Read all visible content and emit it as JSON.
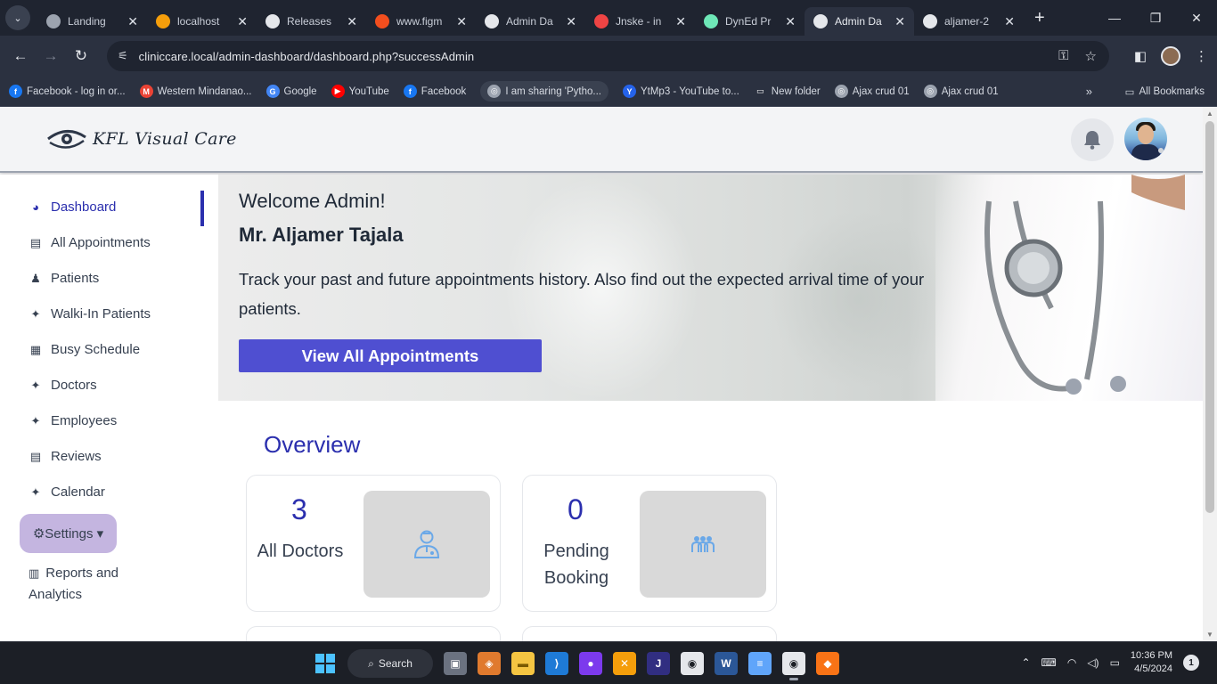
{
  "browser": {
    "tabs": [
      {
        "title": "Landing",
        "color": "#9ca3af"
      },
      {
        "title": "localhost",
        "color": "#f59e0b"
      },
      {
        "title": "Releases",
        "color": "#e5e7eb"
      },
      {
        "title": "www.figm",
        "color": "#f24e1e"
      },
      {
        "title": "Admin Da",
        "color": "#e5e7eb"
      },
      {
        "title": "Jnske - in",
        "color": "#ef4444"
      },
      {
        "title": "DynEd Pr",
        "color": "#6ee7b7"
      },
      {
        "title": "Admin Da",
        "color": "#e5e7eb"
      },
      {
        "title": "aljamer-2",
        "color": "#e5e7eb"
      }
    ],
    "url": "cliniccare.local/admin-dashboard/dashboard.php?successAdmin",
    "bookmarks": [
      {
        "label": "Facebook - log in or...",
        "color": "#1877f2",
        "glyph": "f"
      },
      {
        "label": "Western Mindanao...",
        "color": "#ea4335",
        "glyph": "M"
      },
      {
        "label": "Google",
        "color": "#4285f4",
        "glyph": "G"
      },
      {
        "label": "YouTube",
        "color": "#ff0000",
        "glyph": "▶"
      },
      {
        "label": "Facebook",
        "color": "#1877f2",
        "glyph": "f"
      },
      {
        "label": "I am sharing 'Pytho...",
        "color": "#9ca3af",
        "glyph": "◎"
      },
      {
        "label": "YtMp3 - YouTube to...",
        "color": "#2563eb",
        "glyph": "Y"
      },
      {
        "label": "New folder",
        "color": "transparent",
        "glyph": "▭"
      },
      {
        "label": "Ajax crud 01",
        "color": "#9ca3af",
        "glyph": "◎"
      },
      {
        "label": "Ajax crud 01",
        "color": "#9ca3af",
        "glyph": "◎"
      }
    ],
    "all_bookmarks": "All Bookmarks"
  },
  "app": {
    "brand": "KFL Visual Care",
    "sidebar": {
      "items": [
        {
          "label": "Dashboard",
          "icon": "dashboard-icon",
          "glyph": "◕"
        },
        {
          "label": "All Appointments",
          "icon": "file-icon",
          "glyph": "▤"
        },
        {
          "label": "Patients",
          "icon": "user-icon",
          "glyph": "♟"
        },
        {
          "label": "Walki-In Patients",
          "icon": "users-icon",
          "glyph": "✦"
        },
        {
          "label": "Busy Schedule",
          "icon": "calendar-icon",
          "glyph": "▦"
        },
        {
          "label": "Doctors",
          "icon": "users-icon",
          "glyph": "✦"
        },
        {
          "label": "Employees",
          "icon": "users-icon",
          "glyph": "✦"
        },
        {
          "label": "Reviews",
          "icon": "file-icon",
          "glyph": "▤"
        },
        {
          "label": "Calendar",
          "icon": "users-icon",
          "glyph": "✦"
        }
      ],
      "settings": "⚙Settings ▾",
      "reports": "Reports and Analytics"
    },
    "hero": {
      "welcome": "Welcome Admin!",
      "name": "Mr. Aljamer Tajala",
      "tagline": "Track your past and future appointments history. Also find out the expected arrival time of your patients.",
      "cta": "View All Appointments"
    },
    "overview": {
      "title": "Overview",
      "cards": [
        {
          "value": "3",
          "label": "All Doctors",
          "icon": "doctor-icon"
        },
        {
          "value": "0",
          "label": "Pending Booking",
          "icon": "group-icon"
        }
      ]
    }
  },
  "taskbar": {
    "search": "Search",
    "time": "10:36 PM",
    "date": "4/5/2024",
    "notifications": "1"
  },
  "colors": {
    "accent": "#2b2fae",
    "button": "#4f4fd1",
    "settings_bg": "#c4b5e0"
  }
}
